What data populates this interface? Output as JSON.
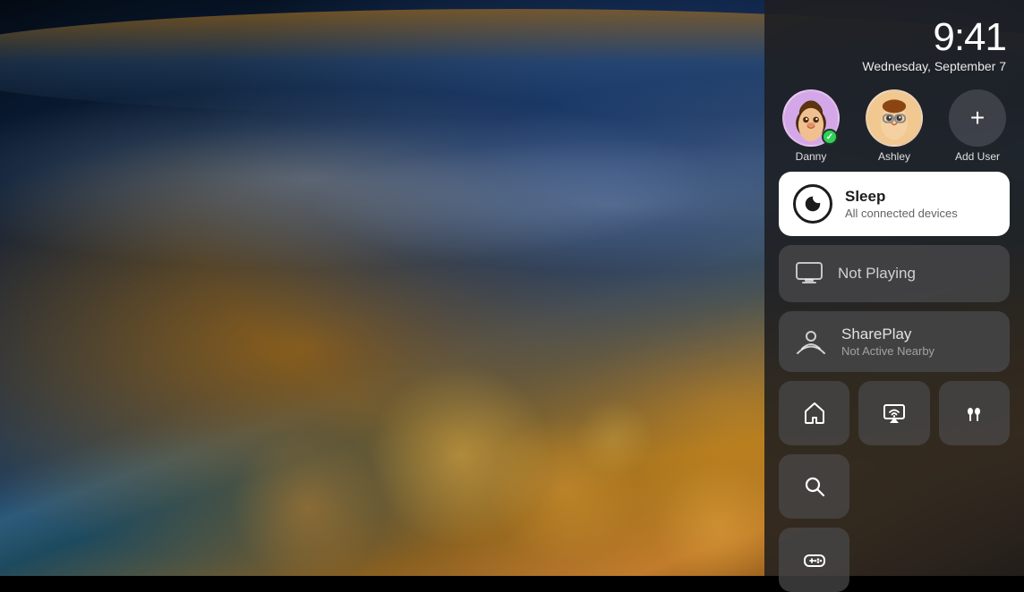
{
  "background": {
    "description": "Earth from space with city lights and atmosphere"
  },
  "time": {
    "hours_minutes": "9:41",
    "date": "Wednesday, September 7"
  },
  "users": [
    {
      "name": "Danny",
      "emoji": "🧑🏿",
      "active": true,
      "label": "Danny"
    },
    {
      "name": "Ashley",
      "emoji": "😎",
      "active": false,
      "label": "Ashley"
    }
  ],
  "add_user": {
    "label": "Add User",
    "icon": "+"
  },
  "sleep_card": {
    "title": "Sleep",
    "subtitle": "All connected devices"
  },
  "now_playing": {
    "label": "Not Playing"
  },
  "shareplay": {
    "title": "SharePlay",
    "subtitle": "Not Active Nearby"
  },
  "grid_buttons": [
    {
      "id": "home",
      "icon_name": "home-icon"
    },
    {
      "id": "airplay",
      "icon_name": "airplay-icon"
    },
    {
      "id": "airpods",
      "icon_name": "airpods-icon"
    },
    {
      "id": "search",
      "icon_name": "search-icon"
    },
    {
      "id": "gamecontroller",
      "icon_name": "game-controller-icon"
    }
  ]
}
